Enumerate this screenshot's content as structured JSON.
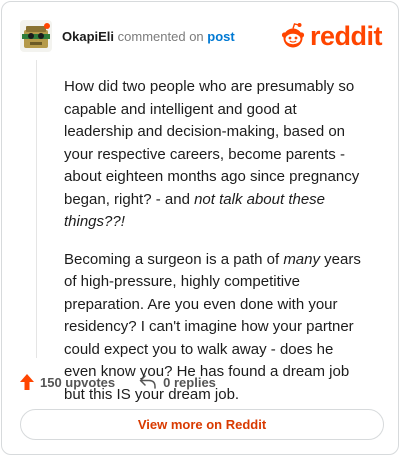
{
  "header": {
    "username": "OkapiEli",
    "action_text": "commented on",
    "post_link": "post"
  },
  "logo": {
    "wordmark": "reddit",
    "icon": "reddit-snoo-icon",
    "color": "#ff4500"
  },
  "comment": {
    "paragraph1_plain": "How did two people who are presumably so capable and intelligent and good at leadership and decision-making, based on your respective careers, become parents - about eighteen months ago since pregnancy began, right? - and ",
    "paragraph1_italic": "not talk about these things??!",
    "paragraph2_pre": "Becoming a surgeon is a path of ",
    "paragraph2_italic": "many",
    "paragraph2_post": " years of high-pressure, highly competitive preparation. Are you even done with your residency? I can't imagine how your partner could expect you to walk away - does he even know you? He has found a dream job but this IS your dream job."
  },
  "footer": {
    "upvotes": "150 upvotes",
    "replies": "0 replies",
    "upvote_icon": "upvote-arrow-icon",
    "reply_icon": "reply-arrow-icon",
    "upvote_color": "#ff4500"
  },
  "cta": {
    "label": "View more on Reddit",
    "color": "#d93a00"
  }
}
